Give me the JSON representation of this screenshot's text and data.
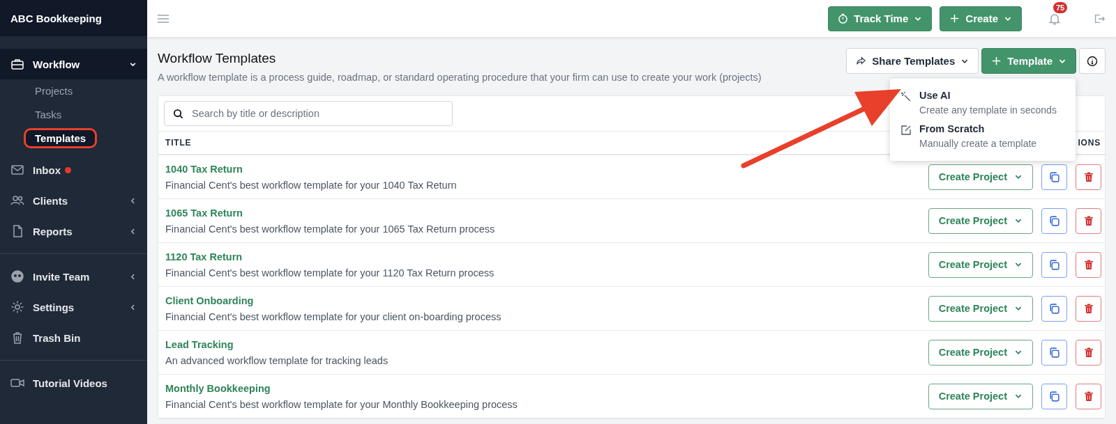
{
  "sidebar": {
    "brand": "ABC Bookkeeping",
    "sections": [
      [
        {
          "label": "Workflow",
          "expanded": true,
          "selected": true,
          "children": [
            {
              "label": "Projects",
              "selected": false,
              "highlighted": false
            },
            {
              "label": "Tasks",
              "selected": false,
              "highlighted": false
            },
            {
              "label": "Templates",
              "selected": true,
              "highlighted": true
            }
          ]
        },
        {
          "label": "Inbox",
          "unread": true
        },
        {
          "label": "Clients",
          "expanded": false
        },
        {
          "label": "Reports",
          "expanded": false
        }
      ],
      [
        {
          "label": "Invite Team",
          "expanded": false
        },
        {
          "label": "Settings",
          "expanded": false
        },
        {
          "label": "Trash Bin"
        }
      ],
      [
        {
          "label": "Tutorial Videos"
        }
      ]
    ]
  },
  "topbar": {
    "track_time": "Track Time",
    "create": "Create",
    "notifications": "75"
  },
  "page": {
    "title": "Workflow Templates",
    "subtitle": "A workflow template is a process guide, roadmap, or standard operating procedure that your firm can use to create your work (projects)",
    "share": "Share Templates",
    "template": "Template",
    "menu": [
      {
        "label": "Use AI",
        "hint": "Create any template in seconds"
      },
      {
        "label": "From Scratch",
        "hint": "Manually create a template"
      }
    ]
  },
  "table": {
    "search": {
      "placeholder": "Search by title or description"
    },
    "columns": [
      "TITLE",
      "IONS"
    ],
    "rows": [
      {
        "title": "1040 Tax Return",
        "description": "Financial Cent's best workflow template for your 1040 Tax Return",
        "action": "Create Project"
      },
      {
        "title": "1065 Tax Return",
        "description": "Financial Cent's best workflow template for your 1065 Tax Return process",
        "action": "Create Project"
      },
      {
        "title": "1120 Tax Return",
        "description": "Financial Cent's best workflow template for your 1120 Tax Return process",
        "action": "Create Project"
      },
      {
        "title": "Client Onboarding",
        "description": "Financial Cent's best workflow template for your client on-boarding process",
        "action": "Create Project"
      },
      {
        "title": "Lead Tracking",
        "description": "An advanced workflow template for tracking leads",
        "action": "Create Project"
      },
      {
        "title": "Monthly Bookkeeping",
        "description": "Financial Cent's best workflow template for your Monthly Bookkeeping process",
        "action": "Create Project"
      }
    ]
  }
}
